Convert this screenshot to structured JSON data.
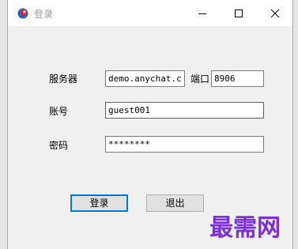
{
  "window": {
    "title": "登录",
    "icons": {
      "app": "app-logo-icon",
      "minimize": "minimize-icon",
      "maximize": "maximize-icon",
      "close": "close-icon"
    }
  },
  "form": {
    "server_label": "服务器",
    "server_value": "demo.anychat.cn",
    "port_label": "端口",
    "port_value": "8906",
    "account_label": "账号",
    "account_value": "guest001",
    "password_label": "密码",
    "password_value": "********"
  },
  "buttons": {
    "login": "登录",
    "exit": "退出"
  },
  "watermark": "最需网",
  "colors": {
    "accent": "#0078d7",
    "watermark": "#7b2fd6"
  }
}
